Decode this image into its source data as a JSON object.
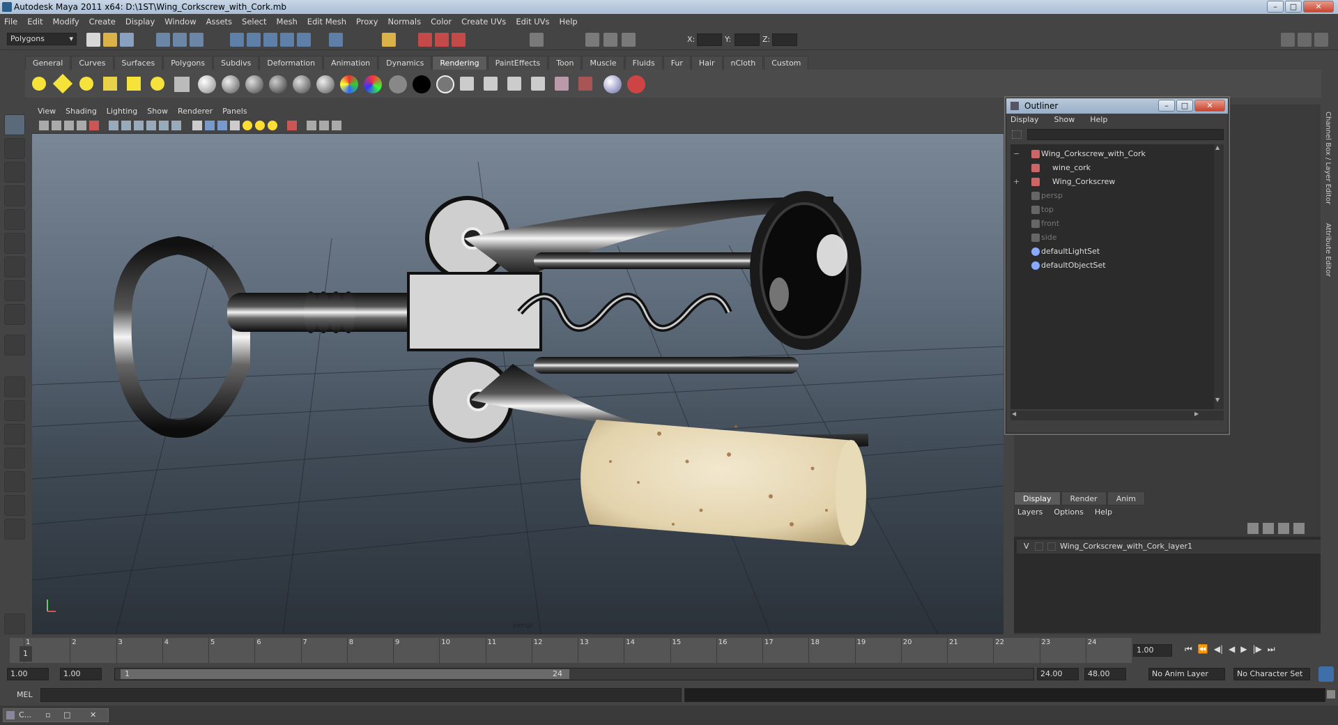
{
  "window": {
    "title": "Autodesk Maya 2011 x64: D:\\1ST\\Wing_Corkscrew_with_Cork.mb"
  },
  "menubar": {
    "items": [
      "File",
      "Edit",
      "Modify",
      "Create",
      "Display",
      "Window",
      "Assets",
      "Select",
      "Mesh",
      "Edit Mesh",
      "Proxy",
      "Normals",
      "Color",
      "Create UVs",
      "Edit UVs",
      "Help"
    ]
  },
  "toolbar": {
    "mode": "Polygons",
    "x_label": "X:",
    "y_label": "Y:",
    "z_label": "Z:"
  },
  "shelf": {
    "tabs": [
      "General",
      "Curves",
      "Surfaces",
      "Polygons",
      "Subdivs",
      "Deformation",
      "Animation",
      "Dynamics",
      "Rendering",
      "PaintEffects",
      "Toon",
      "Muscle",
      "Fluids",
      "Fur",
      "Hair",
      "nCloth",
      "Custom"
    ],
    "active_tab": "Rendering"
  },
  "viewport": {
    "menus": [
      "View",
      "Shading",
      "Lighting",
      "Show",
      "Renderer",
      "Panels"
    ],
    "camera_label": "persp"
  },
  "outliner": {
    "title": "Outliner",
    "menus": [
      "Display",
      "Show",
      "Help"
    ],
    "items": [
      {
        "label": "Wing_Corkscrew_with_Cork",
        "expand": "−"
      },
      {
        "label": "wine_cork",
        "expand": ""
      },
      {
        "label": "Wing_Corkscrew",
        "expand": "+"
      },
      {
        "label": "persp",
        "expand": ""
      },
      {
        "label": "top",
        "expand": ""
      },
      {
        "label": "front",
        "expand": ""
      },
      {
        "label": "side",
        "expand": ""
      },
      {
        "label": "defaultLightSet",
        "expand": ""
      },
      {
        "label": "defaultObjectSet",
        "expand": ""
      }
    ]
  },
  "side_tabs": [
    "Channel Box / Layer Editor",
    "Attribute Editor"
  ],
  "layer_editor": {
    "tabs": [
      "Display",
      "Render",
      "Anim"
    ],
    "active_tab": "Display",
    "menus": [
      "Layers",
      "Options",
      "Help"
    ],
    "layer": {
      "visibility": "V",
      "name": "Wing_Corkscrew_with_Cork_layer1"
    }
  },
  "timeline": {
    "ticks": [
      "1",
      "2",
      "3",
      "4",
      "5",
      "6",
      "7",
      "8",
      "9",
      "10",
      "11",
      "12",
      "13",
      "14",
      "15",
      "16",
      "17",
      "18",
      "19",
      "20",
      "21",
      "22",
      "23",
      "24"
    ],
    "current_frame": "1.00",
    "current_marker": "1"
  },
  "range": {
    "start": "1.00",
    "playback_start": "1.00",
    "slider_start": "1",
    "slider_end": "24",
    "playback_end": "24.00",
    "end": "48.00",
    "anim_layer": "No Anim Layer",
    "character_set": "No Character Set"
  },
  "command_line": {
    "label": "MEL"
  },
  "taskbar": {
    "item": "C..."
  }
}
